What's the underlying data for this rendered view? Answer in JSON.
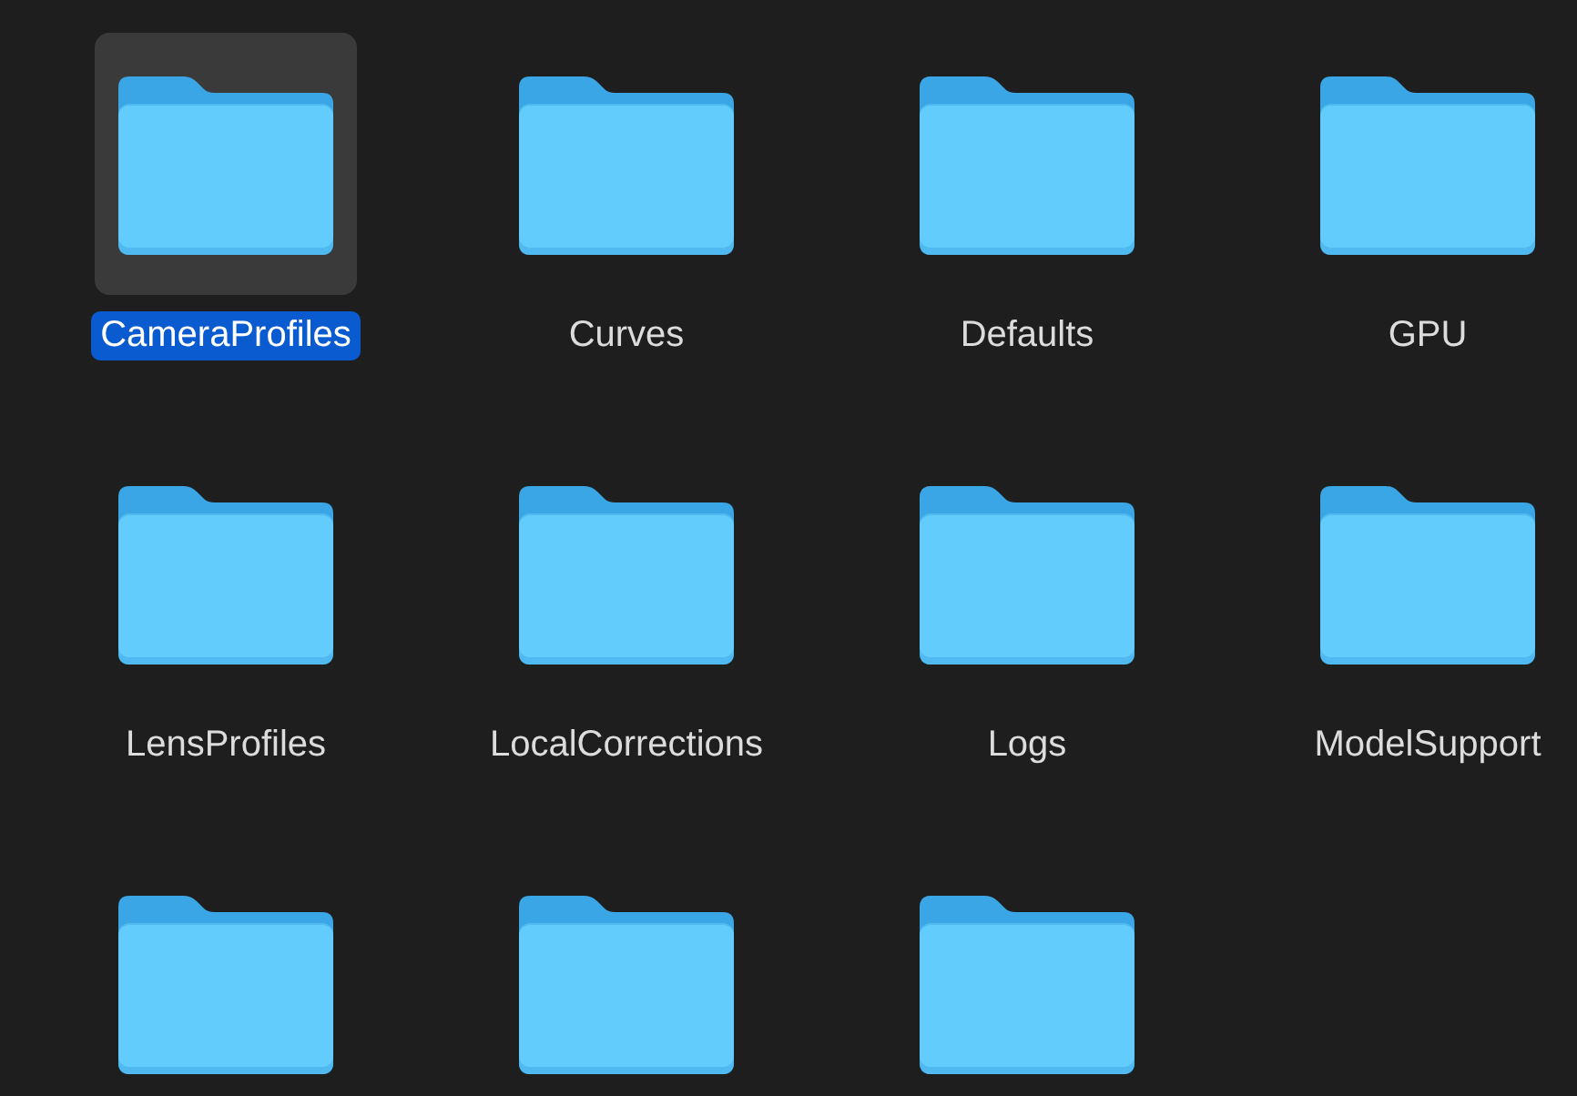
{
  "folders": [
    {
      "name": "CameraProfiles",
      "selected": true
    },
    {
      "name": "Curves",
      "selected": false
    },
    {
      "name": "Defaults",
      "selected": false
    },
    {
      "name": "GPU",
      "selected": false
    },
    {
      "name": "LensProfiles",
      "selected": false
    },
    {
      "name": "LocalCorrections",
      "selected": false
    },
    {
      "name": "Logs",
      "selected": false
    },
    {
      "name": "ModelSupport",
      "selected": false
    },
    {
      "selected": false
    },
    {
      "selected": false
    },
    {
      "selected": false
    }
  ]
}
